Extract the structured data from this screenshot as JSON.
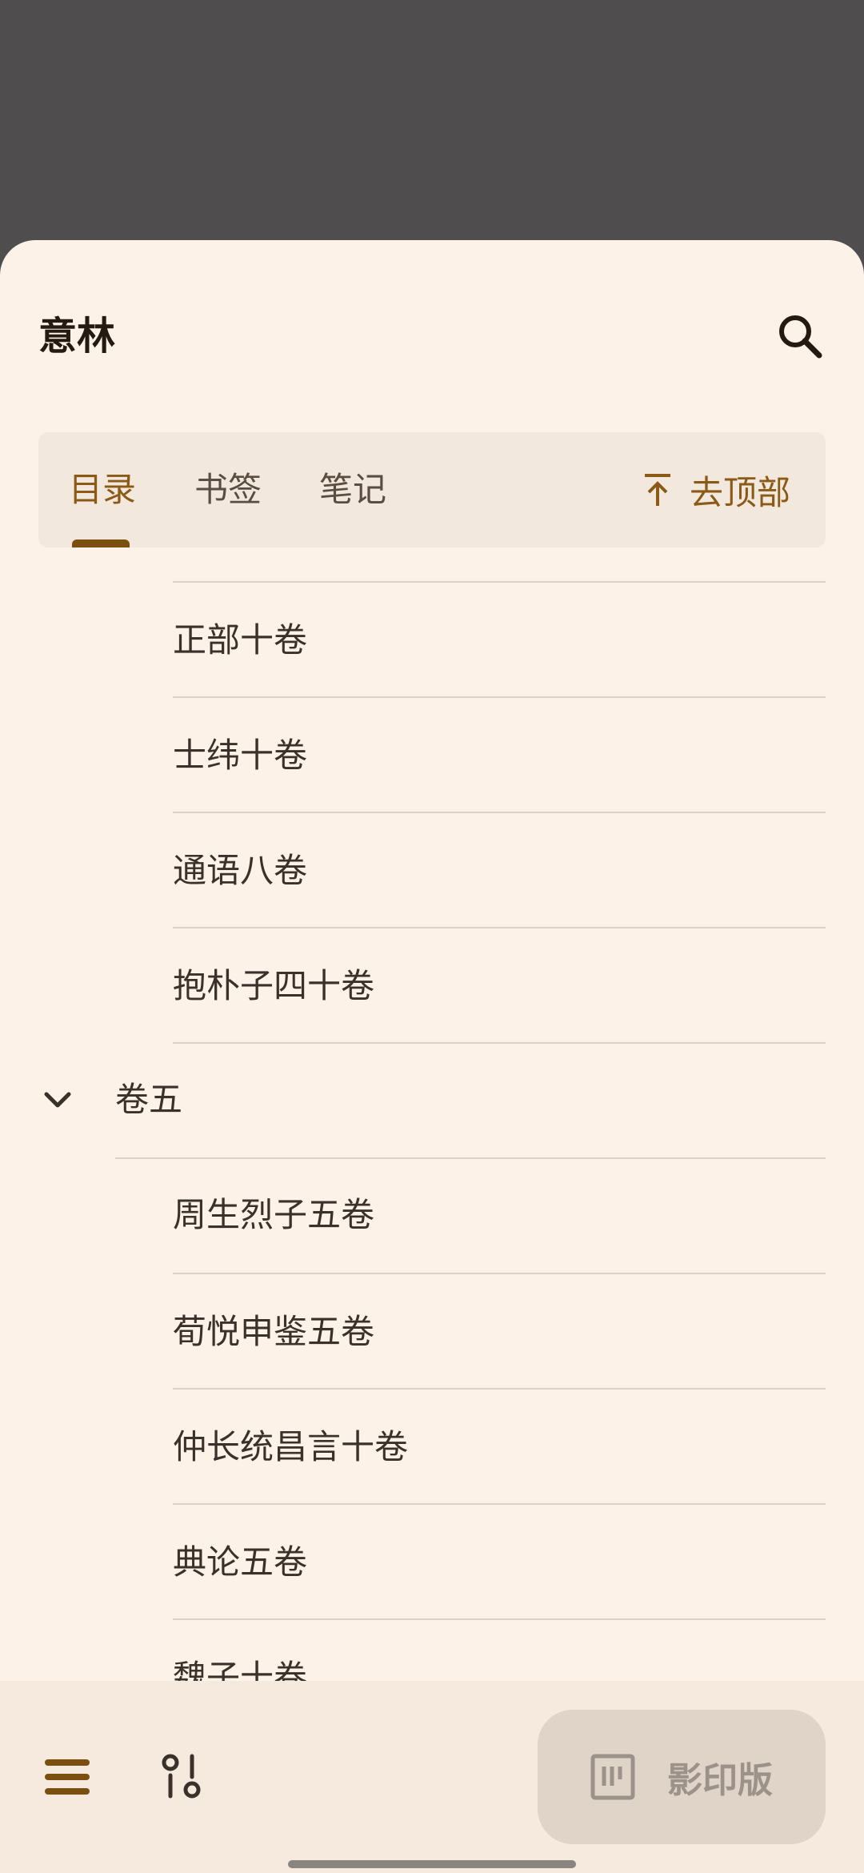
{
  "header": {
    "title": "意林"
  },
  "tabs": [
    {
      "label": "目录",
      "active": true
    },
    {
      "label": "书签",
      "active": false
    },
    {
      "label": "笔记",
      "active": false
    }
  ],
  "to_top_label": "去顶部",
  "toc": {
    "items_before": [
      "正部十卷",
      "士纬十卷",
      "通语八卷",
      "抱朴子四十卷"
    ],
    "section_label": "卷五",
    "items_after": [
      "周生烈子五卷",
      "荀悦申鉴五卷",
      "仲长统昌言十卷",
      "典论五卷",
      "魏子十卷"
    ]
  },
  "bottom": {
    "facsimile_label": "影印版"
  },
  "colors": {
    "accent": "#8a5a16",
    "sheet_bg": "#fcf2e7",
    "scrim": "#4f4d4e"
  }
}
